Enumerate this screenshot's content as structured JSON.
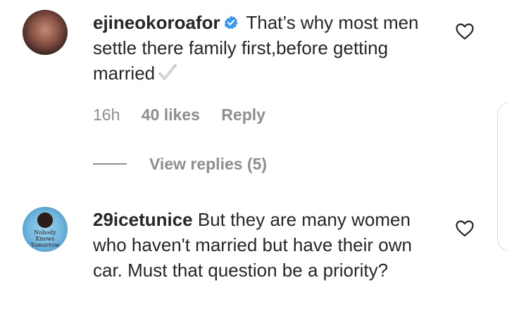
{
  "comments": [
    {
      "username": "ejineokoroafor",
      "verified": true,
      "text": "That’s why most men settle there family first,before getting married",
      "emoji": "heavy-check-mark",
      "time": "16h",
      "likes": "40 likes",
      "reply_label": "Reply",
      "view_replies": "View replies (5)"
    },
    {
      "username": "29icetunice",
      "verified": false,
      "text": "But they are many women who haven't married but have their own car. Must that question be a priority?",
      "avatar_text": [
        "Nobody",
        "Knows",
        "Tomorrow"
      ]
    }
  ],
  "colors": {
    "primary_text": "#262626",
    "secondary_text": "#8e8e8e",
    "verified_badge": "#3897f0"
  }
}
